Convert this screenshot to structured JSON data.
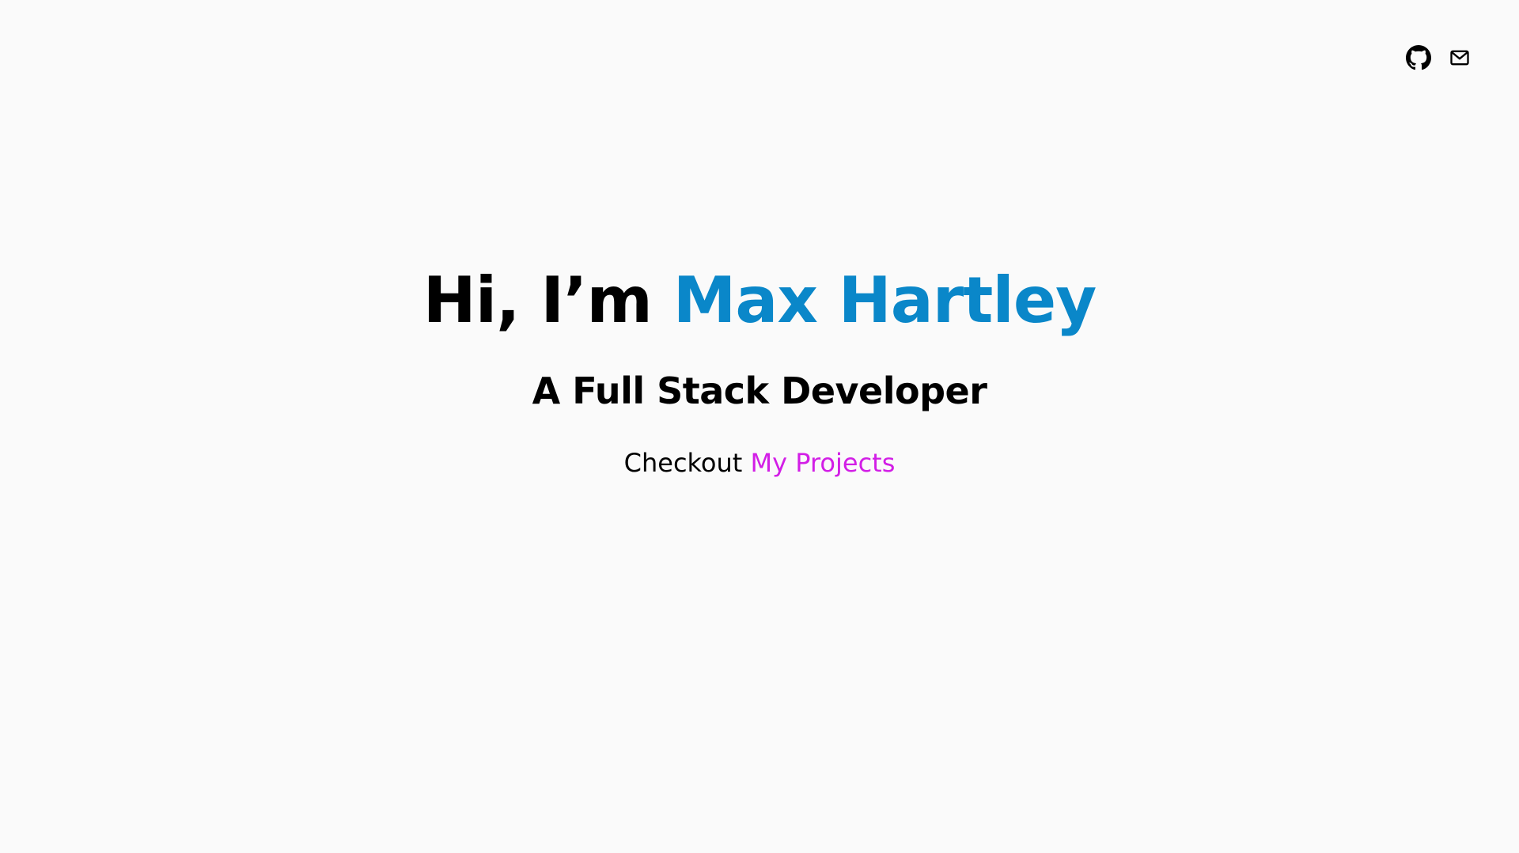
{
  "nav": {
    "icons": [
      {
        "name": "github-icon",
        "label": "GitHub"
      },
      {
        "name": "mail-icon",
        "label": "Email"
      }
    ]
  },
  "hero": {
    "greeting": "Hi, I’m",
    "name": "Max Hartley",
    "tagline": "A Full Stack Developer",
    "cta_prefix": "Checkout",
    "cta_link": "My Projects"
  },
  "colors": {
    "background": "#fafafa",
    "name_accent": "#0a87c9",
    "link_accent": "#d21ee6",
    "text": "#000000"
  }
}
